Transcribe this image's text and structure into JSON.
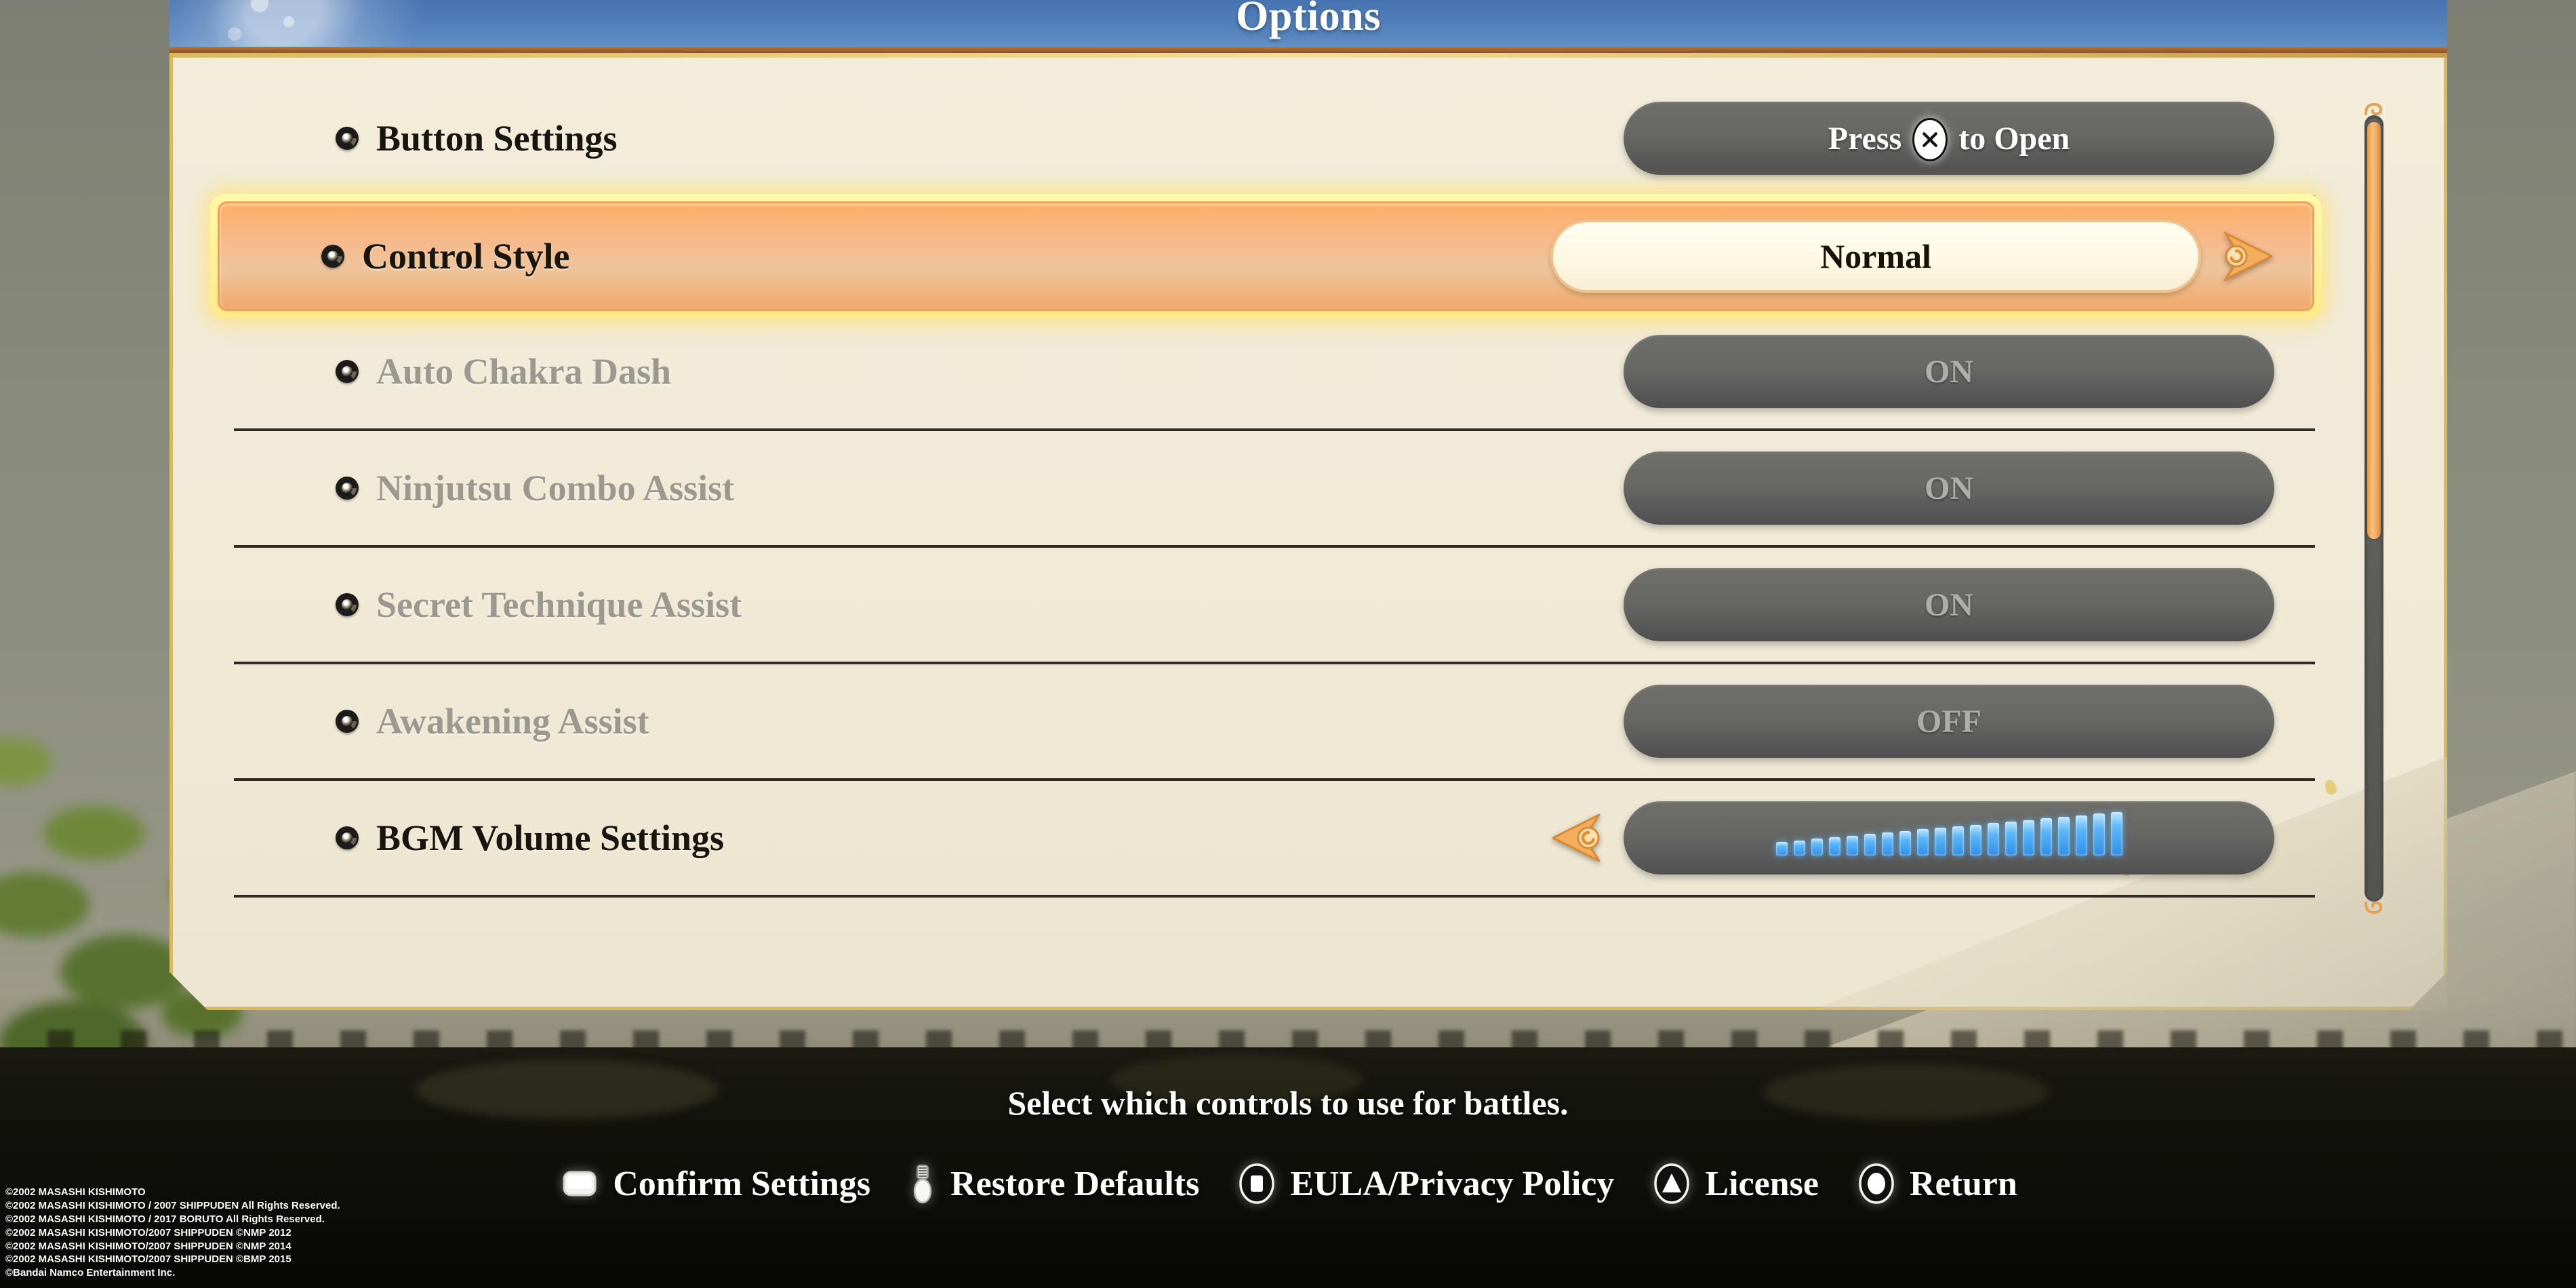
{
  "header": {
    "title": "Options"
  },
  "options": [
    {
      "label": "Button Settings",
      "control": "pill",
      "value_prefix": "Press",
      "value_icon": "cross-button-icon",
      "value_suffix": "to Open",
      "state": "enabled",
      "selected": false
    },
    {
      "label": "Control Style",
      "control": "value-stepper",
      "value": "Normal",
      "state": "enabled",
      "selected": true
    },
    {
      "label": "Auto Chakra Dash",
      "control": "pill",
      "value": "ON",
      "state": "disabled",
      "selected": false
    },
    {
      "label": "Ninjutsu Combo Assist",
      "control": "pill",
      "value": "ON",
      "state": "disabled",
      "selected": false
    },
    {
      "label": "Secret Technique Assist",
      "control": "pill",
      "value": "ON",
      "state": "disabled",
      "selected": false
    },
    {
      "label": "Awakening Assist",
      "control": "pill",
      "value": "OFF",
      "state": "disabled",
      "selected": false
    },
    {
      "label": "BGM Volume Settings",
      "control": "volume-bars",
      "value_bars_total": 20,
      "value_bars_filled": 20,
      "state": "enabled",
      "selected": false
    }
  ],
  "scrollbar": {
    "thumb_percent": 53
  },
  "footer": {
    "hint": "Select which controls to use for battles.",
    "commands": [
      {
        "icon": "shoulder-button-icon",
        "label": "Confirm Settings"
      },
      {
        "icon": "analog-stick-icon",
        "label": "Restore Defaults"
      },
      {
        "icon": "square-button-icon",
        "label": "EULA/Privacy Policy"
      },
      {
        "icon": "triangle-button-icon",
        "label": "License"
      },
      {
        "icon": "circle-button-icon",
        "label": "Return"
      }
    ]
  },
  "copyright": [
    "©2002 MASASHI KISHIMOTO",
    "©2002 MASASHI KISHIMOTO / 2007 SHIPPUDEN All Rights Reserved.",
    "©2002 MASASHI KISHIMOTO / 2017 BORUTO All Rights Reserved.",
    "©2002 MASASHI KISHIMOTO/2007 SHIPPUDEN ©NMP 2012",
    "©2002 MASASHI KISHIMOTO/2007 SHIPPUDEN ©NMP 2014",
    "©2002 MASASHI KISHIMOTO/2007 SHIPPUDEN ©BMP 2015",
    "©Bandai Namco Entertainment Inc."
  ],
  "colors": {
    "panel_bg": "#f0ead7",
    "panel_border": "#d9b85f",
    "title_blue": "#4c79b5",
    "selected_orange": "#f7b887",
    "selected_glow": "#ffe98a",
    "pill_gray": "#66665f",
    "bar_cyan": "#5cb6f7",
    "scroll_thumb": "#f2ab5c"
  }
}
